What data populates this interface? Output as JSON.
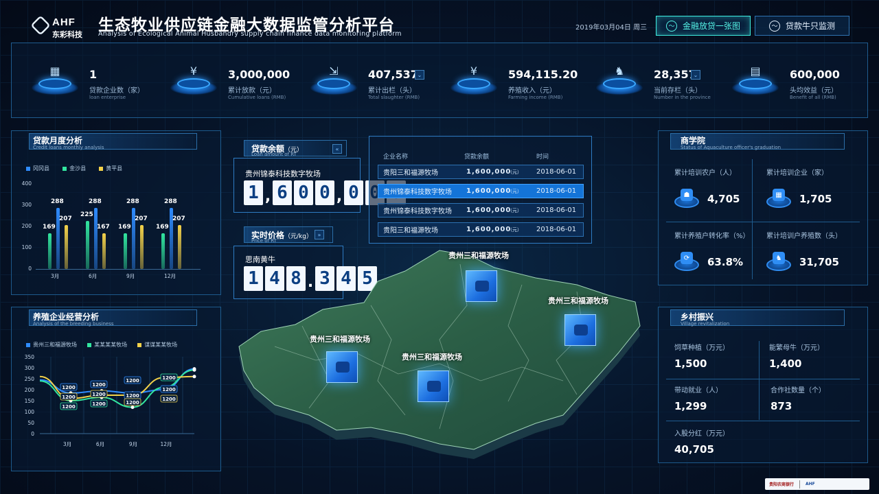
{
  "header": {
    "logo_text": "AHF",
    "logo_sub": "东彩科技",
    "title": "生态牧业供应链金融大数据监管分析平台",
    "subtitle": "Analysis of Ecological Animal Husbandry supply chain finance data monitoring platform",
    "date": "2019年03月04日  周三",
    "btn_loan_map": "金融放贷一张图",
    "btn_cattle": "贷款牛只监测"
  },
  "stats": [
    {
      "icon": "building-icon",
      "value": "1",
      "label": "贷款企业数（家）",
      "en": "loan enterprise"
    },
    {
      "icon": "yen-download-icon",
      "value": "3,000,000",
      "label": "累计放款（元）",
      "en": "Cumulative loans  (RMB)"
    },
    {
      "icon": "export-icon",
      "value": "407,537",
      "label": "累计出栏（头）",
      "en": "Total slaughter  (RMB)"
    },
    {
      "icon": "money-bag-icon",
      "value": "594,115.20",
      "label": "养殖收入（元）",
      "en": "Farming income  (RMB)"
    },
    {
      "icon": "cattle-icon",
      "value": "28,357",
      "label": "当前存栏（头）",
      "en": "Number in the province"
    },
    {
      "icon": "bar-chart-icon",
      "value": "600,000",
      "label": "头均效益（元）",
      "en": "Benefit of all  (RMB)"
    }
  ],
  "loan_monthly": {
    "title": "贷款月度分析",
    "subtitle": "Credit loans monthly analysis",
    "legend": [
      "冈冈县",
      "金沙县",
      "黄平县"
    ],
    "legend_colors": [
      "#2f8cff",
      "#32e6a0",
      "#f3d24a"
    ],
    "y_ticks": [
      "400",
      "300",
      "200",
      "100",
      "0"
    ]
  },
  "breeding": {
    "title": "养殖企业经营分析",
    "subtitle": "Analysis of the breeding business",
    "legend": [
      "贵州三和福源牧场",
      "某某某某牧场",
      "谋谋某某牧场"
    ],
    "legend_colors": [
      "#2f8cff",
      "#32e6a0",
      "#f3d24a"
    ],
    "y_ticks": [
      "350",
      "300",
      "250",
      "200",
      "150",
      "100",
      "50",
      "0"
    ]
  },
  "loan_balance": {
    "title": "贷款余额",
    "unit": "（元）",
    "subtitle": "Loan amount of RT",
    "farm": "贵州锦泰科技数字牧场",
    "digits": [
      "1",
      ",",
      "6",
      "0",
      "0",
      ",",
      "0",
      "0",
      "0"
    ]
  },
  "price": {
    "title": "实时价格",
    "unit": "（元/kg）",
    "subtitle": "Price of RT",
    "name": "思南黄牛",
    "digits": [
      "1",
      "4",
      "8",
      ".",
      "3",
      "4",
      "5"
    ]
  },
  "table": {
    "headers": [
      "企业名称",
      "贷款余额",
      "时间"
    ],
    "unit": "（元）",
    "rows": [
      {
        "name": "贵阳三和福源牧场",
        "amount": "1,600,000",
        "date": "2018-06-01"
      },
      {
        "name": "贵州锦泰科技数字牧场",
        "amount": "1,600,000",
        "date": "2018-06-01"
      },
      {
        "name": "贵州锦泰科技数字牧场",
        "amount": "1,600,000",
        "date": "2018-06-01"
      },
      {
        "name": "贵阳三和福源牧场",
        "amount": "1,600,000",
        "date": "2018-06-01"
      }
    ]
  },
  "map": {
    "markers": [
      "贵州三和福源牧场",
      "贵州三和福源牧场",
      "贵州三和福源牧场",
      "贵州三和福源牧场"
    ]
  },
  "academy": {
    "title": "商学院",
    "subtitle": "Status of Aquaculture officer's graduation",
    "items": [
      {
        "label": "累计培训农户（人）",
        "value": "4,705",
        "icon": "farmer-icon"
      },
      {
        "label": "累计培训企业（家）",
        "value": "1,705",
        "icon": "enterprise-icon"
      },
      {
        "label": "累计养殖户转化率（%）",
        "value": "63.8%",
        "icon": "conversion-icon"
      },
      {
        "label": "累计培训户养殖数（头）",
        "value": "31,705",
        "icon": "cattle-icon"
      }
    ]
  },
  "village": {
    "title": "乡村振兴",
    "subtitle": "Village revitalization",
    "items": [
      {
        "label": "饲草种植（万元）",
        "value": "1,500"
      },
      {
        "label": "能繁母牛（万元）",
        "value": "1,400"
      },
      {
        "label": "带动就业（人）",
        "value": "1,299"
      },
      {
        "label": "合作社数量（个）",
        "value": "873"
      },
      {
        "label": "入股分红（万元）",
        "value": "40,705"
      }
    ]
  },
  "footer": {
    "bank": "贵阳农商银行",
    "logo": "AHF"
  },
  "chart_data": [
    {
      "type": "bar",
      "categories": [
        "3月",
        "6月",
        "9月",
        "12月"
      ],
      "series": [
        {
          "name": "冈冈县",
          "values": [
            288,
            288,
            288,
            288
          ]
        },
        {
          "name": "金沙县",
          "values": [
            169,
            225,
            169,
            169
          ]
        },
        {
          "name": "黄平县",
          "values": [
            207,
            167,
            207,
            207
          ]
        }
      ],
      "ylim": [
        0,
        400
      ]
    },
    {
      "type": "line",
      "categories": [
        "3月",
        "6月",
        "9月",
        "12月"
      ],
      "series": [
        {
          "name": "贵州三和福源牧场",
          "values": [
            245,
            185,
            195,
            185,
            200,
            295
          ]
        },
        {
          "name": "某某某某牧场",
          "values": [
            240,
            150,
            165,
            120,
            210,
            290
          ]
        },
        {
          "name": "谋谋某某牧场",
          "values": [
            260,
            160,
            175,
            175,
            255,
            260
          ]
        }
      ],
      "data_labels": [
        "1200",
        "1200",
        "1200",
        "1200",
        "1200",
        "1200",
        "1200",
        "1200",
        "1200",
        "1200",
        "1200",
        "1200"
      ],
      "ylim": [
        0,
        350
      ]
    }
  ]
}
